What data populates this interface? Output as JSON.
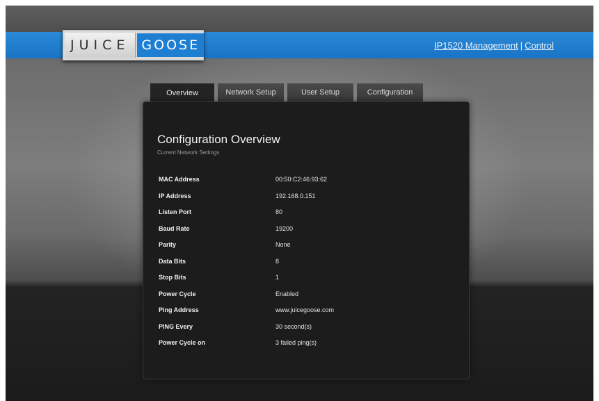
{
  "brand": {
    "logo_part1": "JUICE",
    "logo_part2": "GOOSE"
  },
  "header_links": {
    "management": "IP1520 Management",
    "separator": "|",
    "control": "Control"
  },
  "tabs": [
    {
      "label": "Overview",
      "active": true
    },
    {
      "label": "Network Setup",
      "active": false
    },
    {
      "label": "User Setup",
      "active": false
    },
    {
      "label": "Configuration",
      "active": false
    }
  ],
  "panel": {
    "title": "Configuration Overview",
    "subtitle": "Current Network Settings"
  },
  "settings": [
    {
      "label": "MAC Address",
      "value": "00:50:C2:46:93:62"
    },
    {
      "label": "IP Address",
      "value": "192.168.0.151"
    },
    {
      "label": "Listen Port",
      "value": "80"
    },
    {
      "label": "Baud Rate",
      "value": "19200"
    },
    {
      "label": "Parity",
      "value": "None"
    },
    {
      "label": "Data Bits",
      "value": "8"
    },
    {
      "label": "Stop Bits",
      "value": "1"
    },
    {
      "label": "Power Cycle",
      "value": "Enabled"
    },
    {
      "label": "Ping Address",
      "value": "www.juicegoose.com"
    },
    {
      "label": "PING Every",
      "value": "30 second(s)"
    },
    {
      "label": "Power Cycle on",
      "value": "3 failed ping(s)"
    }
  ],
  "colors": {
    "accent_blue": "#1f7ed2",
    "panel_bg": "#1c1c1c"
  }
}
